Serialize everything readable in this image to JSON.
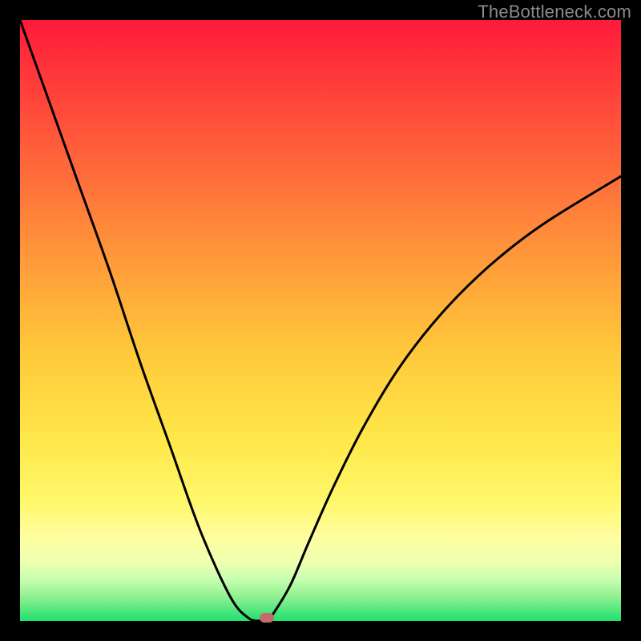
{
  "watermark": {
    "text": "TheBottleneck.com"
  },
  "colors": {
    "background": "#000000",
    "curve": "#000000",
    "marker": "#c46a6a",
    "gradient_top": "#ff1a3a",
    "gradient_bottom": "#20e070"
  },
  "chart_data": {
    "type": "line",
    "title": "",
    "xlabel": "",
    "ylabel": "",
    "xlim": [
      0,
      100
    ],
    "ylim": [
      0,
      100
    ],
    "grid": false,
    "legend": false,
    "x": [
      0,
      5,
      10,
      15,
      20,
      25,
      30,
      35,
      38,
      40,
      41,
      42,
      45,
      48,
      52,
      57,
      63,
      70,
      78,
      87,
      100
    ],
    "values": [
      100,
      86,
      72,
      58,
      43,
      29,
      15,
      4,
      0.5,
      0,
      0,
      1,
      6,
      13,
      22,
      32,
      42,
      51,
      59,
      66,
      74
    ],
    "marker": {
      "x": 41,
      "y": 0
    },
    "notes": "V-shaped bottleneck curve on a vertical red→green gradient; minimum near x≈41 with a small rounded marker at the bottom; values are percentages estimated from pixel positions."
  }
}
